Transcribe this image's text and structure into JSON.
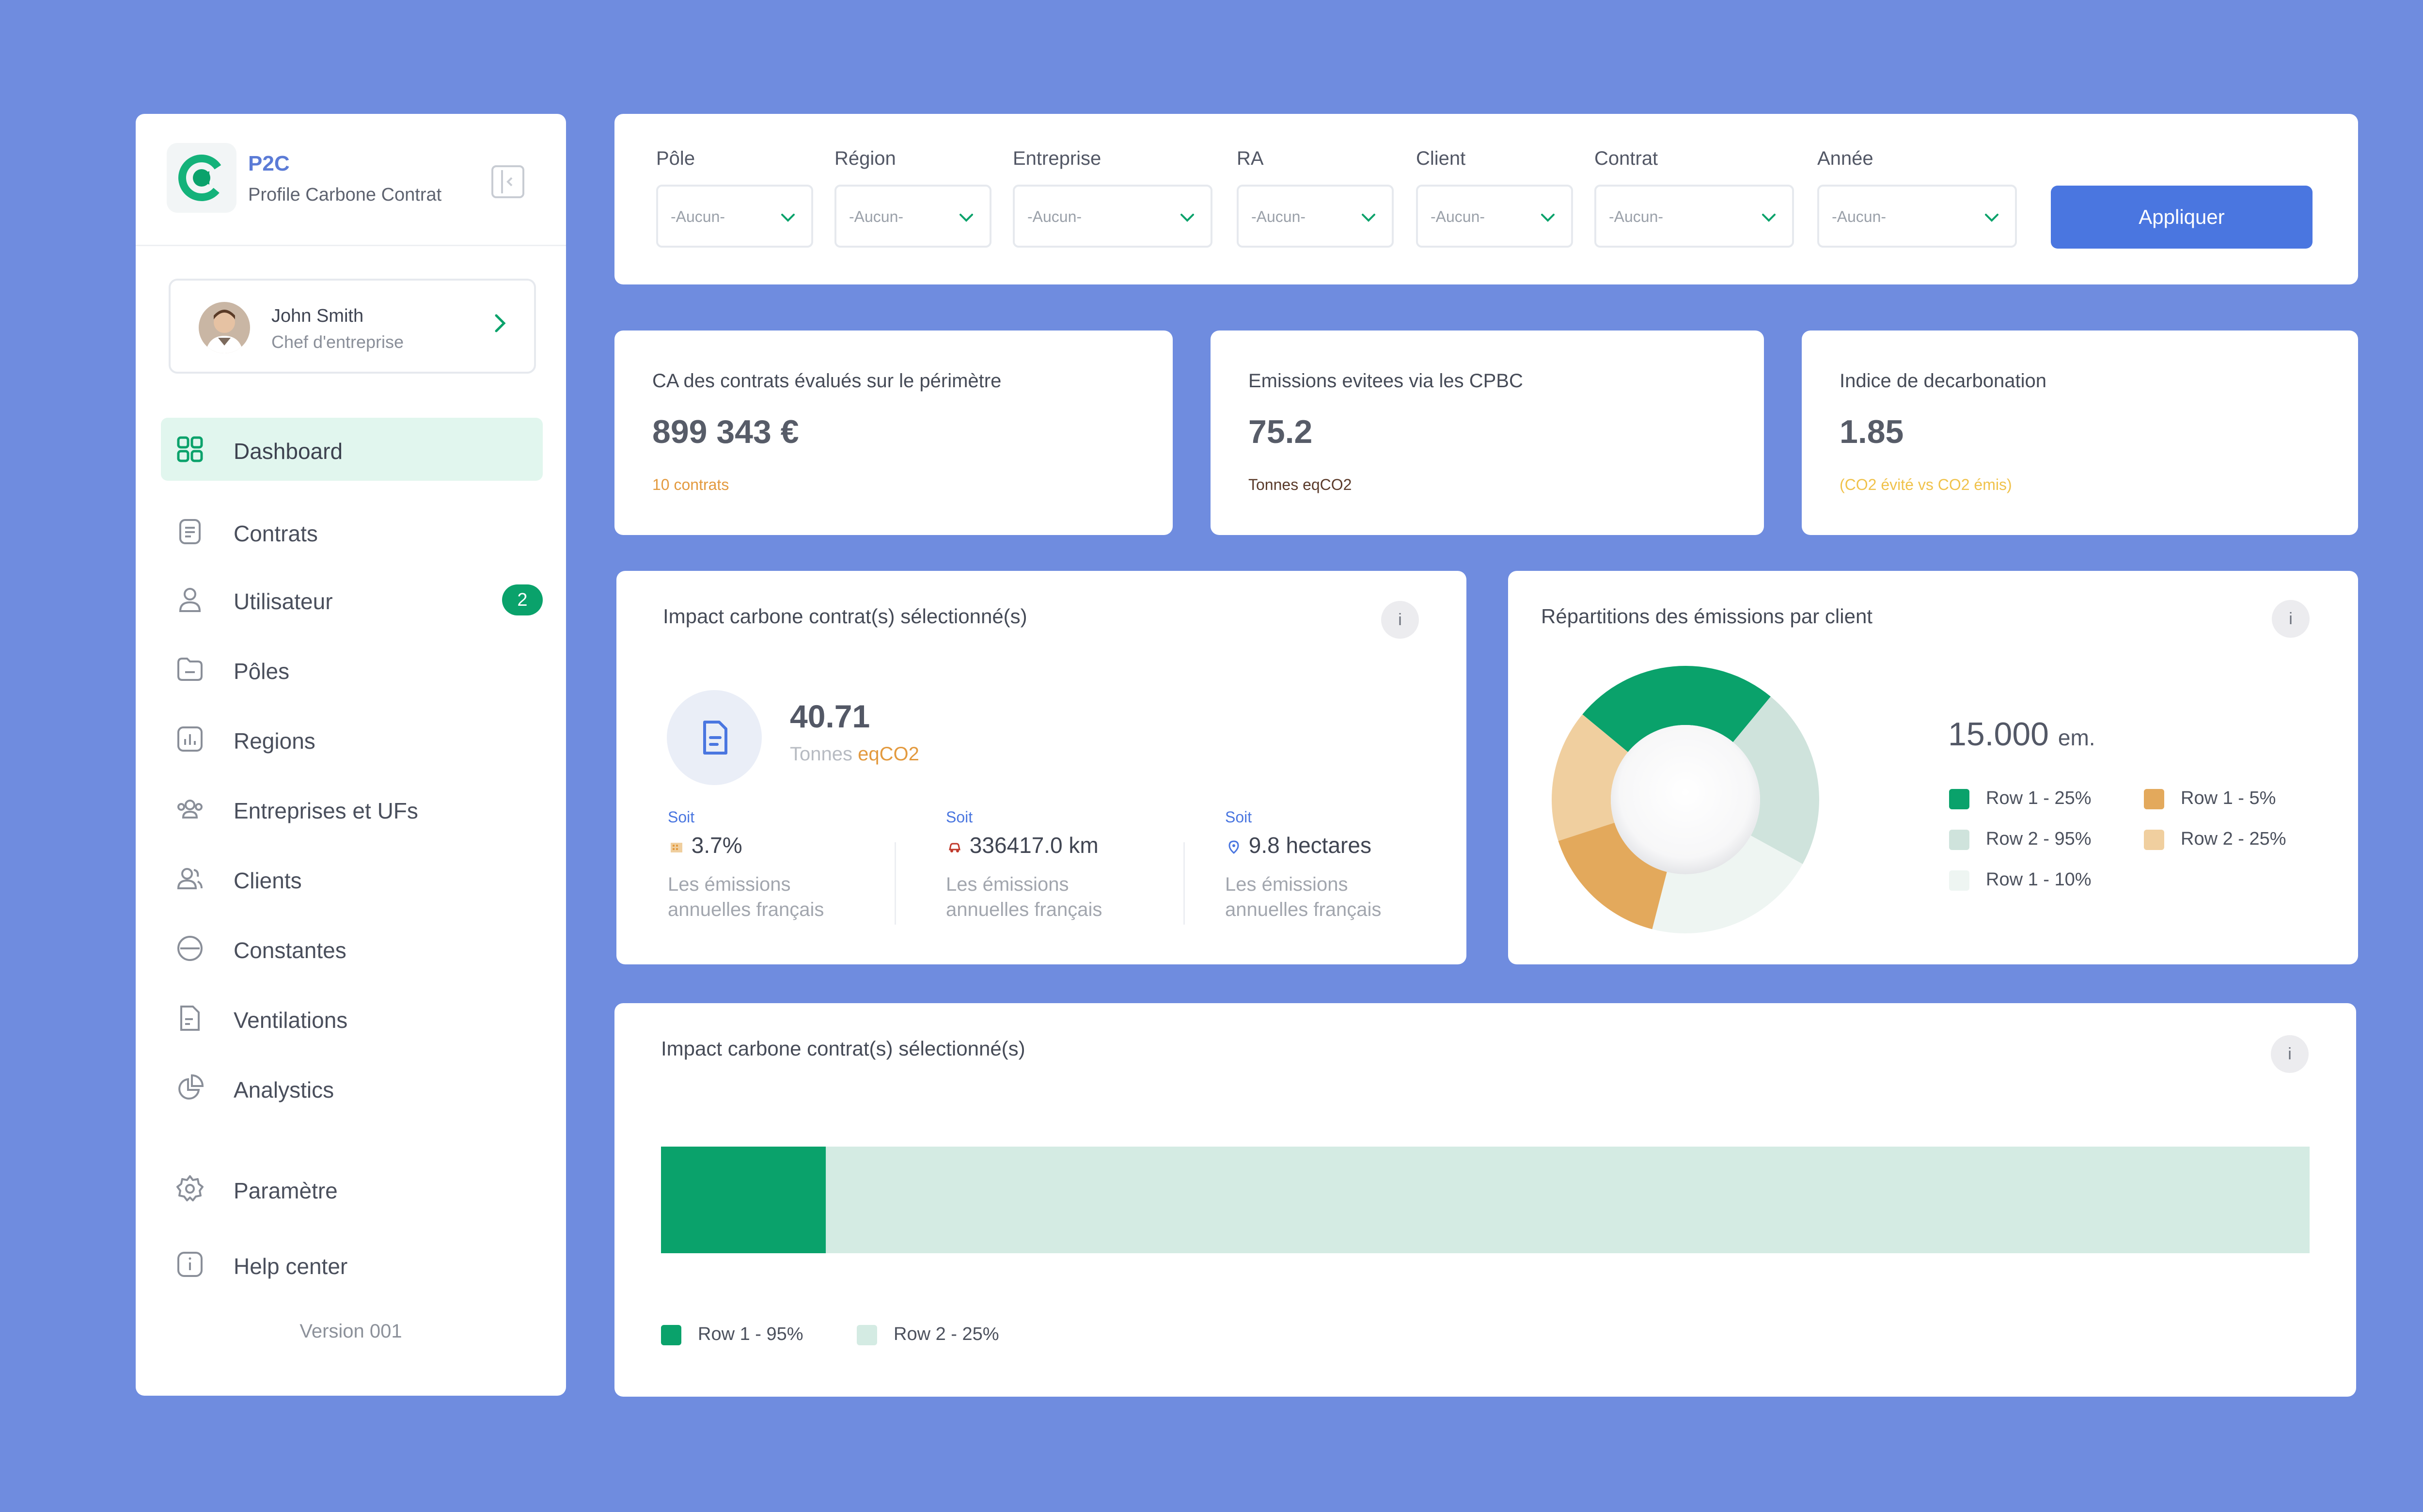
{
  "sidebar": {
    "brand_name": "P2C",
    "brand_subtitle": "Profile Carbone Contrat",
    "user": {
      "name": "John Smith",
      "role": "Chef d'entreprise"
    },
    "nav": [
      {
        "label": "Dashboard",
        "icon": "grid-icon",
        "active": true
      },
      {
        "label": "Contrats",
        "icon": "document-icon"
      },
      {
        "label": "Utilisateur",
        "icon": "user-icon",
        "badge": "2"
      },
      {
        "label": "Pôles",
        "icon": "folder-icon"
      },
      {
        "label": "Regions",
        "icon": "bar-chart-icon"
      },
      {
        "label": "Entreprises et UFs",
        "icon": "users-group-icon"
      },
      {
        "label": "Clients",
        "icon": "clients-icon"
      },
      {
        "label": "Constantes",
        "icon": "minus-circle-icon"
      },
      {
        "label": "Ventilations",
        "icon": "file-icon"
      },
      {
        "label": "Analystics",
        "icon": "pie-chart-icon"
      },
      {
        "label": "Paramètre",
        "icon": "gear-icon"
      },
      {
        "label": "Help center",
        "icon": "info-icon"
      }
    ],
    "version": "Version 001"
  },
  "filters": {
    "fields": [
      {
        "label": "Pôle",
        "value": "-Aucun-"
      },
      {
        "label": "Région",
        "value": "-Aucun-"
      },
      {
        "label": "Entreprise",
        "value": "-Aucun-"
      },
      {
        "label": "RA",
        "value": "-Aucun-"
      },
      {
        "label": "Client",
        "value": "-Aucun-"
      },
      {
        "label": "Contrat",
        "value": "-Aucun-"
      },
      {
        "label": "Année",
        "value": "-Aucun-"
      }
    ],
    "apply_label": "Appliquer"
  },
  "kpis": [
    {
      "title": "CA des contrats évalués sur le périmètre",
      "value": "899 343 €",
      "sub": "10 contrats",
      "sub_color": "#e39a3f"
    },
    {
      "title": "Emissions evitees via les CPBC",
      "value": "75.2",
      "sub": "Tonnes eqCO2",
      "sub_color": "#5a3a2a"
    },
    {
      "title": "Indice de decarbonation",
      "value": "1.85",
      "sub": "(CO2 évité vs CO2 émis)",
      "sub_color": "#f0c24b"
    }
  ],
  "impact": {
    "title": "Impact carbone contrat(s) sélectionné(s)",
    "info": "i",
    "value": "40.71",
    "unit_prefix": "Tonnes",
    "unit_highlight": "eqCO2",
    "equivalents": [
      {
        "label": "Soit",
        "value": "3.7%",
        "icon": "building-icon",
        "desc1": "Les émissions",
        "desc2": "annuelles français"
      },
      {
        "label": "Soit",
        "value": "336417.0 km",
        "icon": "car-icon",
        "desc1": "Les émissions",
        "desc2": "annuelles français"
      },
      {
        "label": "Soit",
        "value": "9.8 hectares",
        "icon": "location-icon",
        "desc1": "Les émissions",
        "desc2": "annuelles français"
      }
    ]
  },
  "donut": {
    "title": "Répartitions des émissions par client",
    "info": "i",
    "total": "15.000",
    "total_unit": "em.",
    "legend": [
      {
        "label": "Row 1 - 25%",
        "color": "#0aa26b"
      },
      {
        "label": "Row 1 - 5%",
        "color": "#e3a95c"
      },
      {
        "label": "Row 2 - 95%",
        "color": "#cfe3dc"
      },
      {
        "label": "Row 2 - 25%",
        "color": "#f0cf9f"
      },
      {
        "label": "Row 1 - 10%",
        "color": "#eef5f2"
      }
    ]
  },
  "bar": {
    "title": "Impact carbone contrat(s) sélectionné(s)",
    "info": "i",
    "legend": [
      {
        "label": "Row 1 - 95%",
        "color": "#0aa26b"
      },
      {
        "label": "Row 2 - 25%",
        "color": "#d4ebe3"
      }
    ]
  },
  "chart_data": [
    {
      "type": "pie",
      "title": "Répartitions des émissions par client",
      "series": [
        {
          "name": "Row 1",
          "value": 25,
          "color": "#0aa26b"
        },
        {
          "name": "Row 1",
          "value": 5,
          "color": "#eef5f2"
        },
        {
          "name": "Row 2",
          "value": 95,
          "color": "#cfe3dc"
        },
        {
          "name": "Row 2",
          "value": 25,
          "color": "#f0cf9f"
        },
        {
          "name": "Row 1",
          "value": 10,
          "color": "#e3a95c"
        }
      ],
      "slices_fraction": [
        0.25,
        0.22,
        0.21,
        0.16,
        0.16
      ],
      "slice_colors": [
        "#0aa26b",
        "#cfe3dc",
        "#eef5f2",
        "#e3a95c",
        "#f0cf9f"
      ]
    },
    {
      "type": "bar",
      "title": "Impact carbone contrat(s) sélectionné(s)",
      "orientation": "horizontal-stacked",
      "segments": [
        {
          "name": "Row 1",
          "fraction": 0.1,
          "color": "#0aa26b"
        },
        {
          "name": "Row 2",
          "fraction": 0.9,
          "color": "#d4ebe3"
        }
      ]
    }
  ]
}
